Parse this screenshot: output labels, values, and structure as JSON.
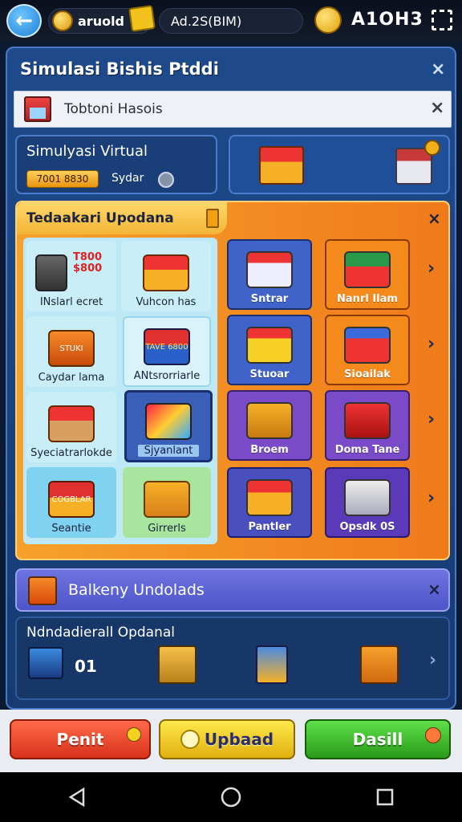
{
  "topbar": {
    "back_icon": "back-arrow-icon",
    "currency_label": "aruold",
    "ad_label": "Ad.2S(BIM)",
    "level_label": "A1OH3",
    "fullscreen_icon": "fullscreen-icon"
  },
  "window": {
    "title": "Simulasi Bishis Ptddi",
    "close_label": "×"
  },
  "subbar": {
    "label": "Tobtoni Hasois",
    "close_label": "×"
  },
  "sim_card": {
    "title": "Simulyasi Virtual",
    "badge": "7001 8830",
    "status": "Sydar"
  },
  "update_panel": {
    "title": "Tedaakari Upodana",
    "close_label": "×",
    "left_tiles": [
      {
        "label": "INslarl ecret",
        "price": "T800 $800"
      },
      {
        "label": "Vuhcon has"
      },
      {
        "label": "Caydar lama",
        "sign": "STUKI"
      },
      {
        "label": "ANtsrorriarle",
        "sign": "TAVE 6800"
      },
      {
        "label": "Syeciatrarlokde"
      },
      {
        "label": "Sjyanlant"
      },
      {
        "label": "Seantie",
        "sign": "COGBLAR"
      },
      {
        "label": "Girrerls"
      }
    ],
    "right_tiles": [
      {
        "label": "Sntrar"
      },
      {
        "label": "Nanrl Ilam"
      },
      {
        "label": "Stuoar"
      },
      {
        "label": "Sioailak"
      },
      {
        "label": "Broem"
      },
      {
        "label": "Doma Tane"
      },
      {
        "label": "Pantler"
      },
      {
        "label": "Opsdk 0S"
      }
    ],
    "chevron": "›"
  },
  "bottom_bar": {
    "title": "Balkeny Undolads",
    "close_label": "×"
  },
  "bottom_section": {
    "title": "Ndndadierall Opdanal",
    "count": "01",
    "chevron": "›"
  },
  "buttons": {
    "left": "Penit",
    "middle": "Upbaad",
    "right": "Dasill"
  },
  "colors": {
    "panel_orange": "#f08a1e",
    "panel_blue": "#1e4a8c",
    "button_red": "#e5402a",
    "button_yellow": "#f2d21d",
    "button_green": "#3dbb2a"
  }
}
